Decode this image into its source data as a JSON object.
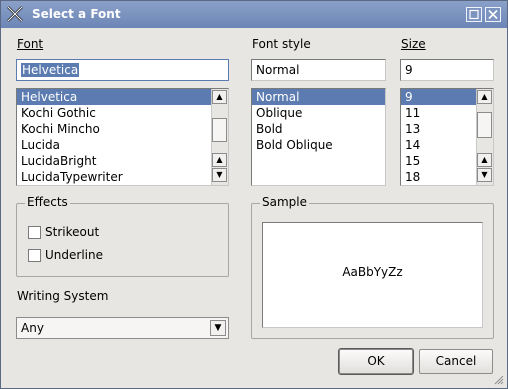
{
  "window": {
    "title": "Select a Font"
  },
  "font": {
    "label": "Font",
    "value": "Helvetica",
    "items": [
      "Helvetica",
      "Kochi Gothic",
      "Kochi Mincho",
      "Lucida",
      "LucidaBright",
      "LucidaTypewriter"
    ],
    "selected_index": 0
  },
  "style": {
    "label": "Font style",
    "value": "Normal",
    "items": [
      "Normal",
      "Oblique",
      "Bold",
      "Bold Oblique"
    ],
    "selected_index": 0
  },
  "size": {
    "label": "Size",
    "value": "9",
    "items": [
      "9",
      "11",
      "13",
      "14",
      "15",
      "18"
    ],
    "selected_index": 0
  },
  "effects": {
    "title": "Effects",
    "strikeout_label": "Strikeout",
    "underline_label": "Underline",
    "strikeout_checked": false,
    "underline_checked": false
  },
  "sample": {
    "title": "Sample",
    "text": "AaBbYyZz"
  },
  "writing_system": {
    "label": "Writing System",
    "value": "Any"
  },
  "buttons": {
    "ok": "OK",
    "cancel": "Cancel"
  },
  "colors": {
    "title_bar": "#6c86b6",
    "selection": "#5b7bb1",
    "dialog_bg": "#e8e6e3"
  }
}
